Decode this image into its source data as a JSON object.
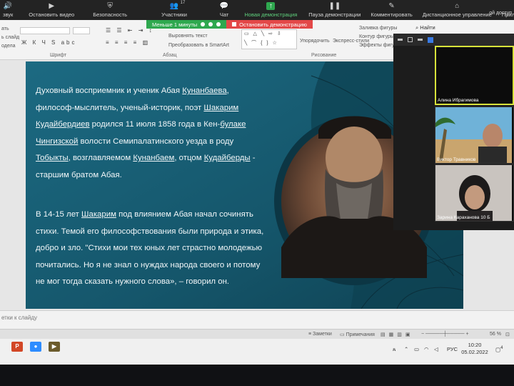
{
  "zoom_toolbar": {
    "items": [
      {
        "label": "звук",
        "icon": "audio-icon"
      },
      {
        "label": "Остановить видео",
        "icon": "video-icon"
      },
      {
        "label": "Безопасность",
        "icon": "shield-icon"
      },
      {
        "label": "Участники",
        "icon": "participants-icon",
        "count": "17"
      },
      {
        "label": "Чат",
        "icon": "chat-icon"
      },
      {
        "label": "Новая демонстрация",
        "icon": "share-icon",
        "accent": "#2fa84f"
      },
      {
        "label": "Пауза демонстрации",
        "icon": "pause-icon"
      },
      {
        "label": "Комментировать",
        "icon": "pen-icon"
      },
      {
        "label": "Дистанционное управление",
        "icon": "remote-icon"
      },
      {
        "label": "Приложения",
        "icon": "apps-icon"
      },
      {
        "label": "Дополнительно",
        "icon": "more-icon"
      }
    ],
    "right_label": "ой доступ"
  },
  "share_bar": {
    "timer": "Меньше 1 минуты",
    "stop_label": "Остановить демонстрацию"
  },
  "ribbon": {
    "font_group": "Шрифт",
    "paragraph_group": "Абзац",
    "drawing_group": "Рисование",
    "align_text": "Выровнять текст",
    "smartart": "Преобразовать в SmartArt",
    "arrange": "Упорядочить",
    "express_styles": "Экспресс-стили",
    "shape_fill": "Заливка фигуры",
    "shape_outline": "Контур фигуры",
    "shape_effects": "Эффекты фигу",
    "find": "Найти",
    "left_labels": [
      "ать",
      "ь слайд",
      "одела"
    ]
  },
  "slide": {
    "para1": [
      [
        {
          "t": "Духовный восприемник и ученик Абая ",
          "u": false
        },
        {
          "t": "Кунанбаева",
          "u": true
        },
        {
          "t": ",",
          "u": false
        }
      ],
      [
        {
          "t": "философ-мыслитель, ученый-историк, поэт ",
          "u": false
        },
        {
          "t": "Шакарим",
          "u": true
        }
      ],
      [
        {
          "t": "Кудайбердиев",
          "u": true
        },
        {
          "t": " родился 11 июля 1858 года в Кен-",
          "u": false
        },
        {
          "t": "булаке",
          "u": true
        }
      ],
      [
        {
          "t": "Чингизской",
          "u": true
        },
        {
          "t": " волости Семипалатинского уезда в роду",
          "u": false
        }
      ],
      [
        {
          "t": "Тобыкты",
          "u": true
        },
        {
          "t": ", возглавляемом ",
          "u": false
        },
        {
          "t": "Кунанбаем",
          "u": true
        },
        {
          "t": ", отцом ",
          "u": false
        },
        {
          "t": "Кудайберды",
          "u": true
        },
        {
          "t": " -",
          "u": false
        }
      ],
      [
        {
          "t": "старшим братом Абая.",
          "u": false
        }
      ]
    ],
    "para2": [
      [
        {
          "t": "В 14-15 лет ",
          "u": false
        },
        {
          "t": "Шакарим",
          "u": true
        },
        {
          "t": " под влиянием Абая начал сочинять",
          "u": false
        }
      ],
      [
        {
          "t": "стихи. Темой его философствования были природа и этика,",
          "u": false
        }
      ],
      [
        {
          "t": "добро и зло. \"Стихи мои тех юных лет страстно молодежью",
          "u": false
        }
      ],
      [
        {
          "t": "почитались. Но я не знал о нуждах народа своего и потому",
          "u": false
        }
      ],
      [
        {
          "t": "не мог тогда сказать нужного слова», – говорил он.",
          "u": false
        }
      ]
    ]
  },
  "zoom_panel": {
    "participants": [
      {
        "name": "Алина Ибрагимова"
      },
      {
        "name": "Виктор Травников"
      },
      {
        "name": "Зарина Караханова 10 Б"
      }
    ]
  },
  "notes_placeholder": "етки к слайду",
  "status": {
    "notes": "Заметки",
    "comments": "Примечания",
    "zoom": "56 %"
  },
  "taskbar": {
    "apps": [
      {
        "label": "P",
        "icon": "powerpoint-icon",
        "color": "#d24726"
      },
      {
        "label": "",
        "icon": "zoom-app-icon",
        "color": "#2d8cff"
      },
      {
        "label": "",
        "icon": "media-player-icon",
        "color": "#6b5b2c"
      }
    ],
    "lang": "РУС",
    "time": "10:20",
    "date": "05.02.2022",
    "notification_count": "4"
  }
}
